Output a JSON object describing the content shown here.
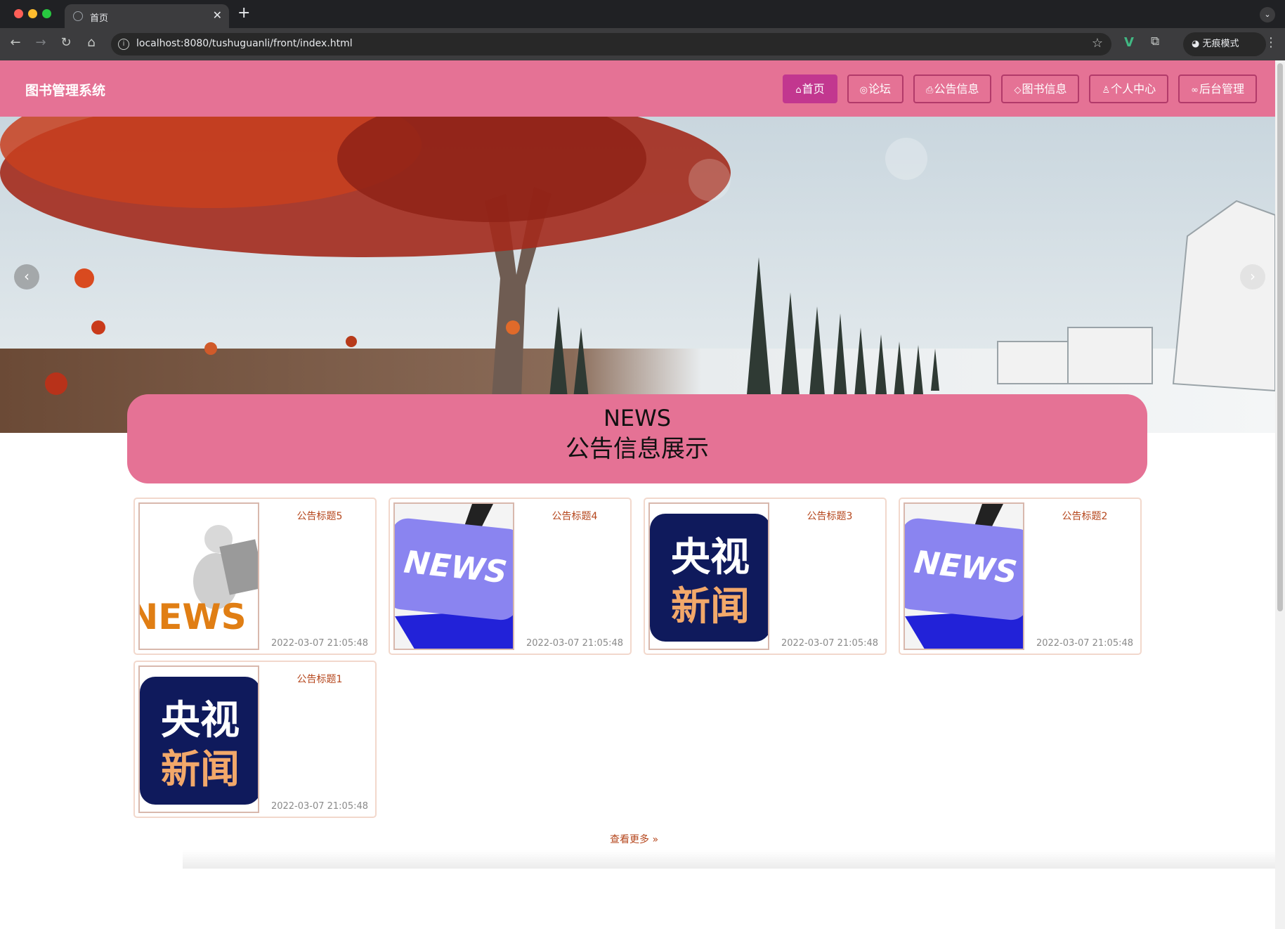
{
  "browser": {
    "tab_title": "首页",
    "tab_close": "✕",
    "new_tab": "+",
    "tab_menu": "⌄",
    "url": "localhost:8080/tushuguanli/front/index.html",
    "incognito_label": "无痕模式",
    "icons": [
      "back-icon",
      "forward-icon",
      "reload-icon",
      "home-icon",
      "info-icon",
      "star-icon",
      "vue-devtools-icon",
      "extensions-icon",
      "incognito-icon",
      "menu-icon"
    ]
  },
  "site": {
    "title": "图书管理系统",
    "accent_color": "#e57295",
    "nav": [
      {
        "icon": "home-icon",
        "glyph": "⌂",
        "label": "首页",
        "active": true
      },
      {
        "icon": "globe-icon",
        "glyph": "◎",
        "label": "论坛"
      },
      {
        "icon": "printer-icon",
        "glyph": "⎙",
        "label": "公告信息"
      },
      {
        "icon": "tag-icon",
        "glyph": "◇",
        "label": "图书信息"
      },
      {
        "icon": "user-icon",
        "glyph": "♙",
        "label": "个人中心"
      },
      {
        "icon": "link-icon",
        "glyph": "∞",
        "label": "后台管理"
      }
    ]
  },
  "banner": {
    "prev": "‹",
    "next": "›",
    "slide_count": 3,
    "active_slide": 1
  },
  "news": {
    "heading_en": "NEWS",
    "heading_cn": "公告信息展示",
    "items": [
      {
        "title": "公告标题5",
        "time": "2022-03-07 21:05:48",
        "image": "news-3d-figure",
        "image_text": "NEWS"
      },
      {
        "title": "公告标题4",
        "time": "2022-03-07 21:05:48",
        "image": "news-blue-key",
        "image_text": "NEWS"
      },
      {
        "title": "公告标题3",
        "time": "2022-03-07 21:05:48",
        "image": "cctv-news-logo",
        "image_text_top": "央视",
        "image_text_bottom": "新闻"
      },
      {
        "title": "公告标题2",
        "time": "2022-03-07 21:05:48",
        "image": "news-blue-key",
        "image_text": "NEWS"
      },
      {
        "title": "公告标题1",
        "time": "2022-03-07 21:05:48",
        "image": "cctv-news-logo",
        "image_text_top": "央视",
        "image_text_bottom": "新闻"
      }
    ],
    "more_label": "查看更多",
    "more_icon": "»"
  }
}
